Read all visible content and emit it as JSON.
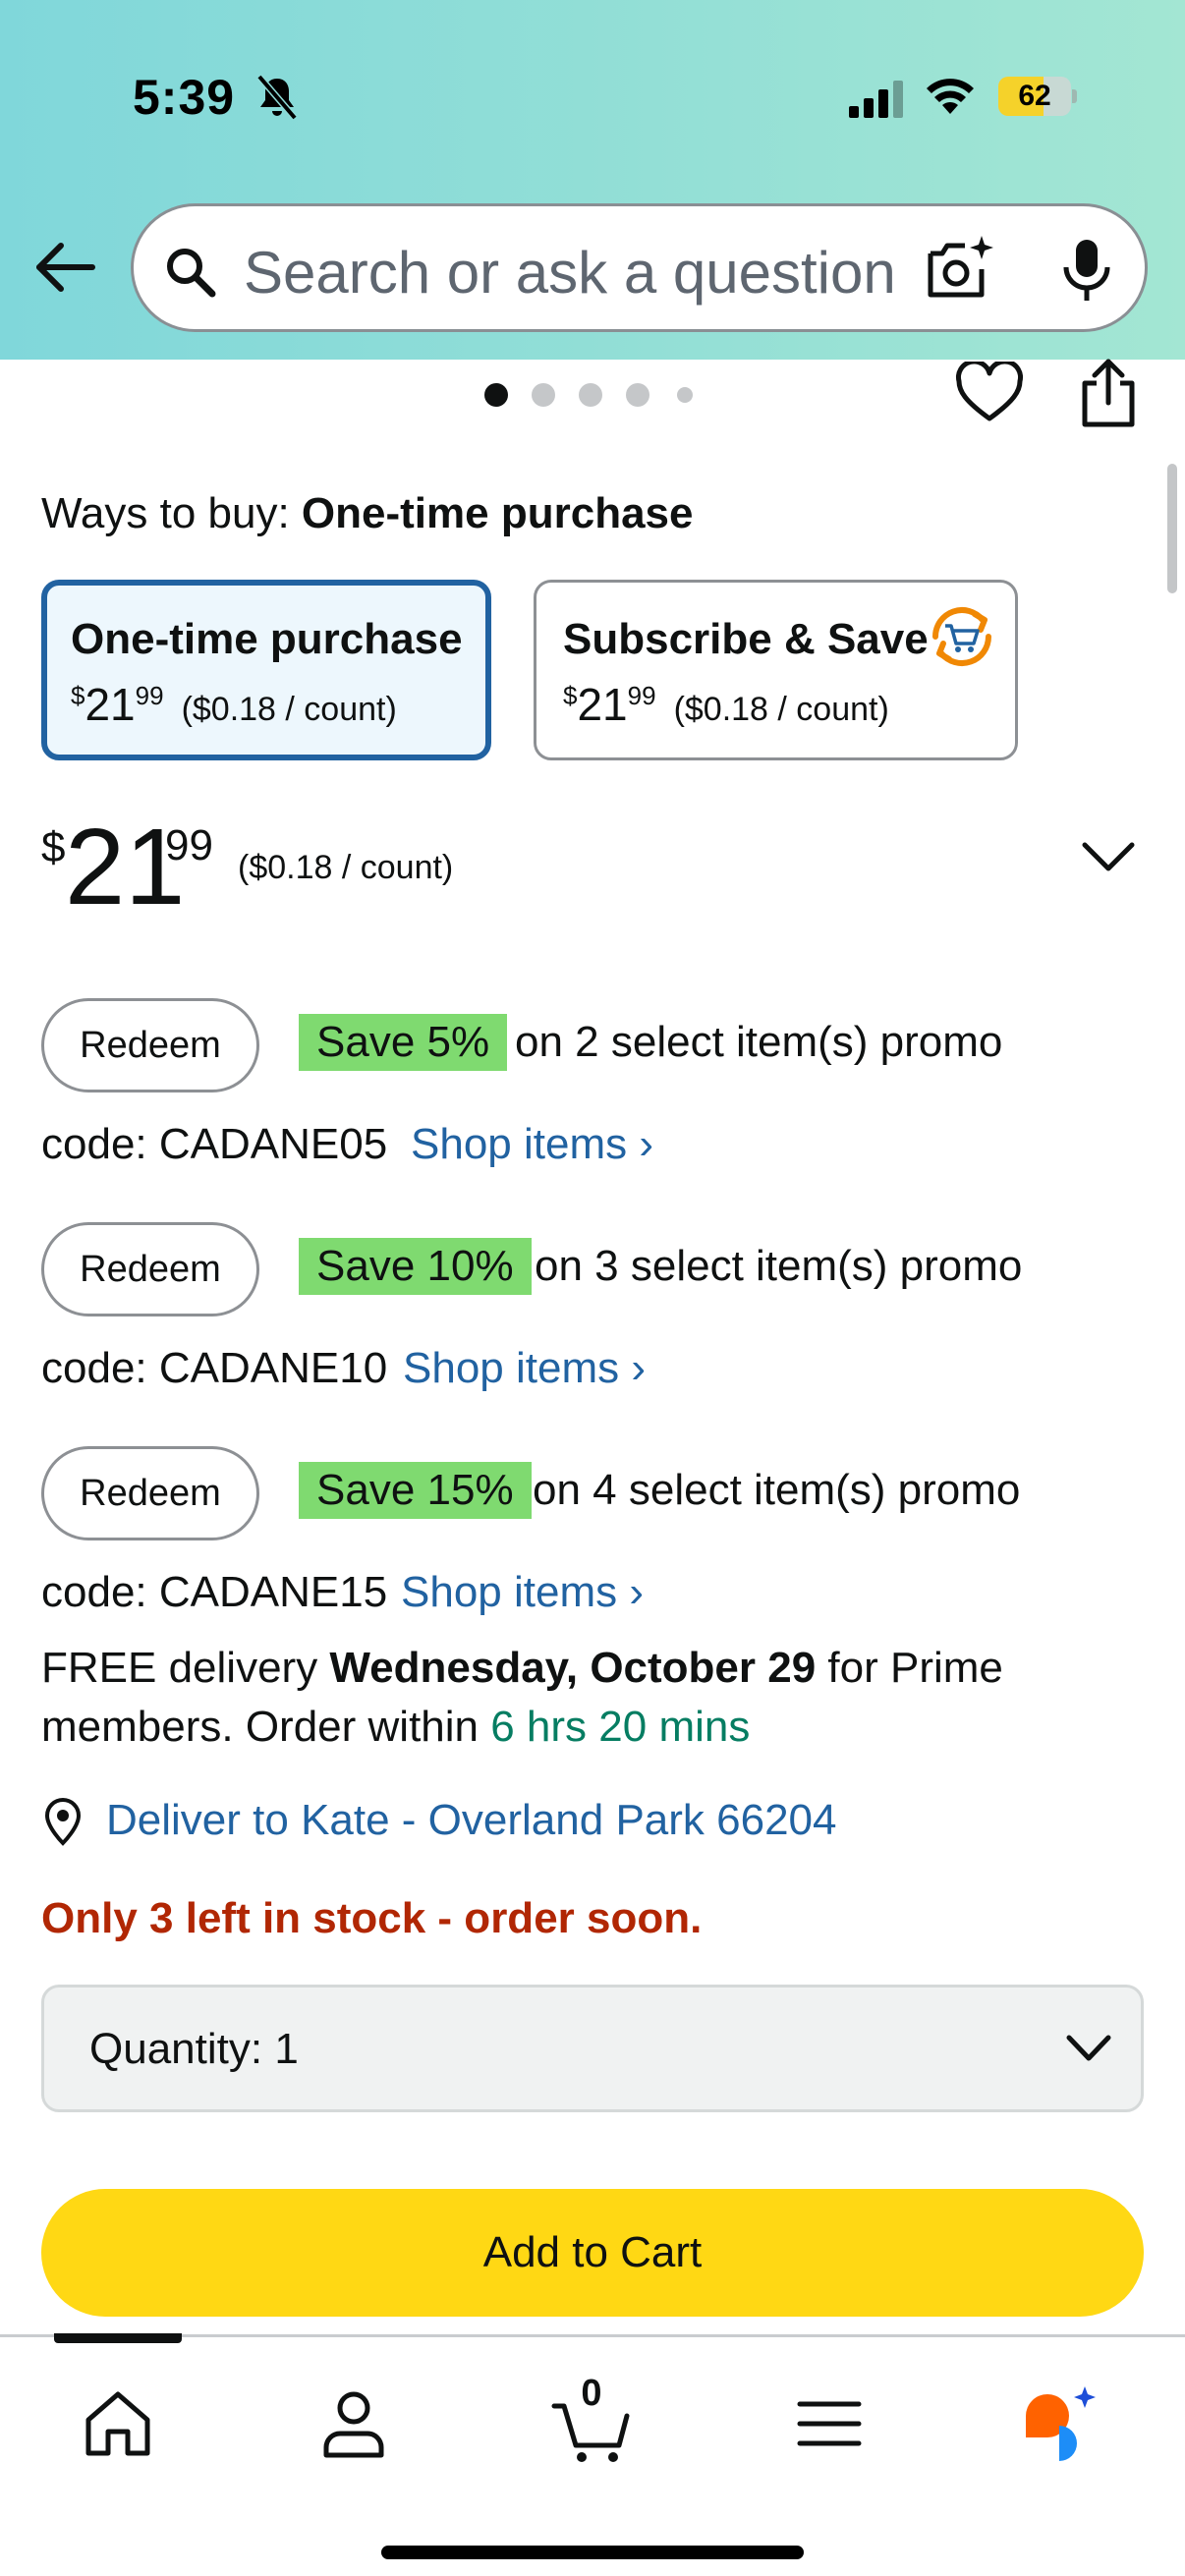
{
  "status_bar": {
    "time": "5:39",
    "battery_level": "62",
    "battery_percent": 62
  },
  "search": {
    "placeholder": "Search or ask a question"
  },
  "carousel": {
    "dot_count": 5,
    "active_index": 0
  },
  "ways_to_buy": {
    "label": "Ways to buy:",
    "selected": "One-time purchase"
  },
  "options": [
    {
      "title": "One-time purchase",
      "currency": "$",
      "price_whole": "21",
      "price_cents": "99",
      "per_unit": "($0.18 / count)"
    },
    {
      "title": "Subscribe & Save",
      "currency": "$",
      "price_whole": "21",
      "price_cents": "99",
      "per_unit": "($0.18 / count)"
    }
  ],
  "price": {
    "currency": "$",
    "whole": "21",
    "cents": "99",
    "per_unit": "($0.18 / count)"
  },
  "promos": [
    {
      "button": "Redeem",
      "badge": "Save 5%",
      "text": "on 2 select item(s) promo",
      "code": "code: CADANE05",
      "link": "Shop items ›"
    },
    {
      "button": "Redeem",
      "badge": "Save 10%",
      "text": "on 3 select item(s) promo",
      "code": "code: CADANE10",
      "link": "Shop items ›"
    },
    {
      "button": "Redeem",
      "badge": "Save 15%",
      "text": "on 4 select item(s) promo",
      "code": "code: CADANE15",
      "link": "Shop items ›"
    }
  ],
  "delivery": {
    "prefix": "FREE delivery ",
    "date": "Wednesday, October 29",
    "middle": " for Prime members. Order within ",
    "countdown": "6 hrs 20 mins"
  },
  "deliver_to": "Deliver to Kate - Overland Park 66204",
  "stock": "Only 3 left in stock - order soon.",
  "quantity": {
    "label": "Quantity:",
    "value": "1"
  },
  "add_to_cart": "Add to Cart",
  "bottom_nav": {
    "cart_count": "0",
    "items": [
      "home-icon",
      "account-icon",
      "cart-icon",
      "menu-icon",
      "rufus-icon"
    ]
  },
  "colors": {
    "link": "#2162a1",
    "stock": "#b12704",
    "countdown": "#067d62",
    "cart_button": "#ffd814",
    "promo_badge": "#7fda70",
    "selected_border": "#2162a1"
  }
}
